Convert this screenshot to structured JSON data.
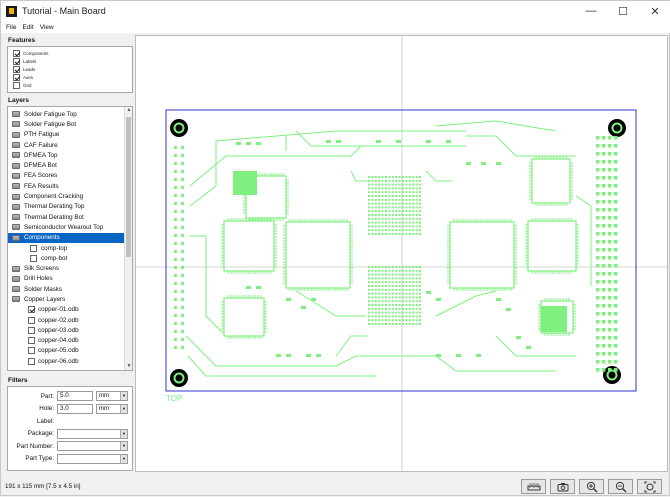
{
  "window": {
    "title": "Tutorial - Main Board",
    "controls": {
      "minimize": "—",
      "maximize": "☐",
      "close": "✕"
    }
  },
  "menu": [
    "File",
    "Edit",
    "View"
  ],
  "features": {
    "title": "Features",
    "items": [
      {
        "label": "Components",
        "checked": true
      },
      {
        "label": "Labels",
        "checked": true
      },
      {
        "label": "Leads",
        "checked": true
      },
      {
        "label": "Axes",
        "checked": true
      },
      {
        "label": "Grid",
        "checked": false
      }
    ]
  },
  "layers": {
    "title": "Layers",
    "items": [
      {
        "label": "Solder Fatigue Top",
        "kind": "folder"
      },
      {
        "label": "Solder Fatigue Bot",
        "kind": "folder"
      },
      {
        "label": "PTH Fatigue",
        "kind": "folder"
      },
      {
        "label": "CAF Failure",
        "kind": "folder"
      },
      {
        "label": "DFMEA Top",
        "kind": "folder"
      },
      {
        "label": "DFMEA Bot",
        "kind": "folder"
      },
      {
        "label": "FEA Scores",
        "kind": "folder"
      },
      {
        "label": "FEA Results",
        "kind": "folder"
      },
      {
        "label": "Component Cracking",
        "kind": "folder"
      },
      {
        "label": "Thermal Derating Top",
        "kind": "folder"
      },
      {
        "label": "Thermal Derating Bot",
        "kind": "folder"
      },
      {
        "label": "Semiconductor Wearout Top",
        "kind": "folder"
      },
      {
        "label": "Components",
        "kind": "folder",
        "selected": true
      },
      {
        "label": "comp-top",
        "kind": "sub",
        "checked": false
      },
      {
        "label": "comp-bot",
        "kind": "sub",
        "checked": false
      },
      {
        "label": "Silk Screens",
        "kind": "folder"
      },
      {
        "label": "Drill Holes",
        "kind": "folder"
      },
      {
        "label": "Solder Masks",
        "kind": "folder"
      },
      {
        "label": "Copper Layers",
        "kind": "folder"
      },
      {
        "label": "copper-01.odb",
        "kind": "child",
        "checked": true
      },
      {
        "label": "copper-02.odb",
        "kind": "child",
        "checked": false
      },
      {
        "label": "copper-03.odb",
        "kind": "child",
        "checked": false
      },
      {
        "label": "copper-04.odb",
        "kind": "child",
        "checked": false
      },
      {
        "label": "copper-05.odb",
        "kind": "child",
        "checked": false
      },
      {
        "label": "copper-06.odb",
        "kind": "child",
        "checked": false
      }
    ]
  },
  "filters": {
    "title": "Filters",
    "part_label": "Part:",
    "part_value": "5.0",
    "part_unit": "mm",
    "hole_label": "Hole:",
    "hole_value": "3.0",
    "hole_unit": "mm",
    "label_label": "Label:",
    "package_label": "Package:",
    "part_number_label": "Part Number:",
    "part_type_label": "Part Type:"
  },
  "board": {
    "side_label": "TOP",
    "trace_color": "#7ff07f",
    "outline_color": "#3333cc"
  },
  "status": {
    "dimensions": "191 x 115 mm  [7.5 x 4.5 in]"
  },
  "toolbar": {
    "icons": [
      "ruler-icon",
      "camera-icon",
      "zoom-in-icon",
      "zoom-out-icon",
      "zoom-fit-icon"
    ]
  }
}
